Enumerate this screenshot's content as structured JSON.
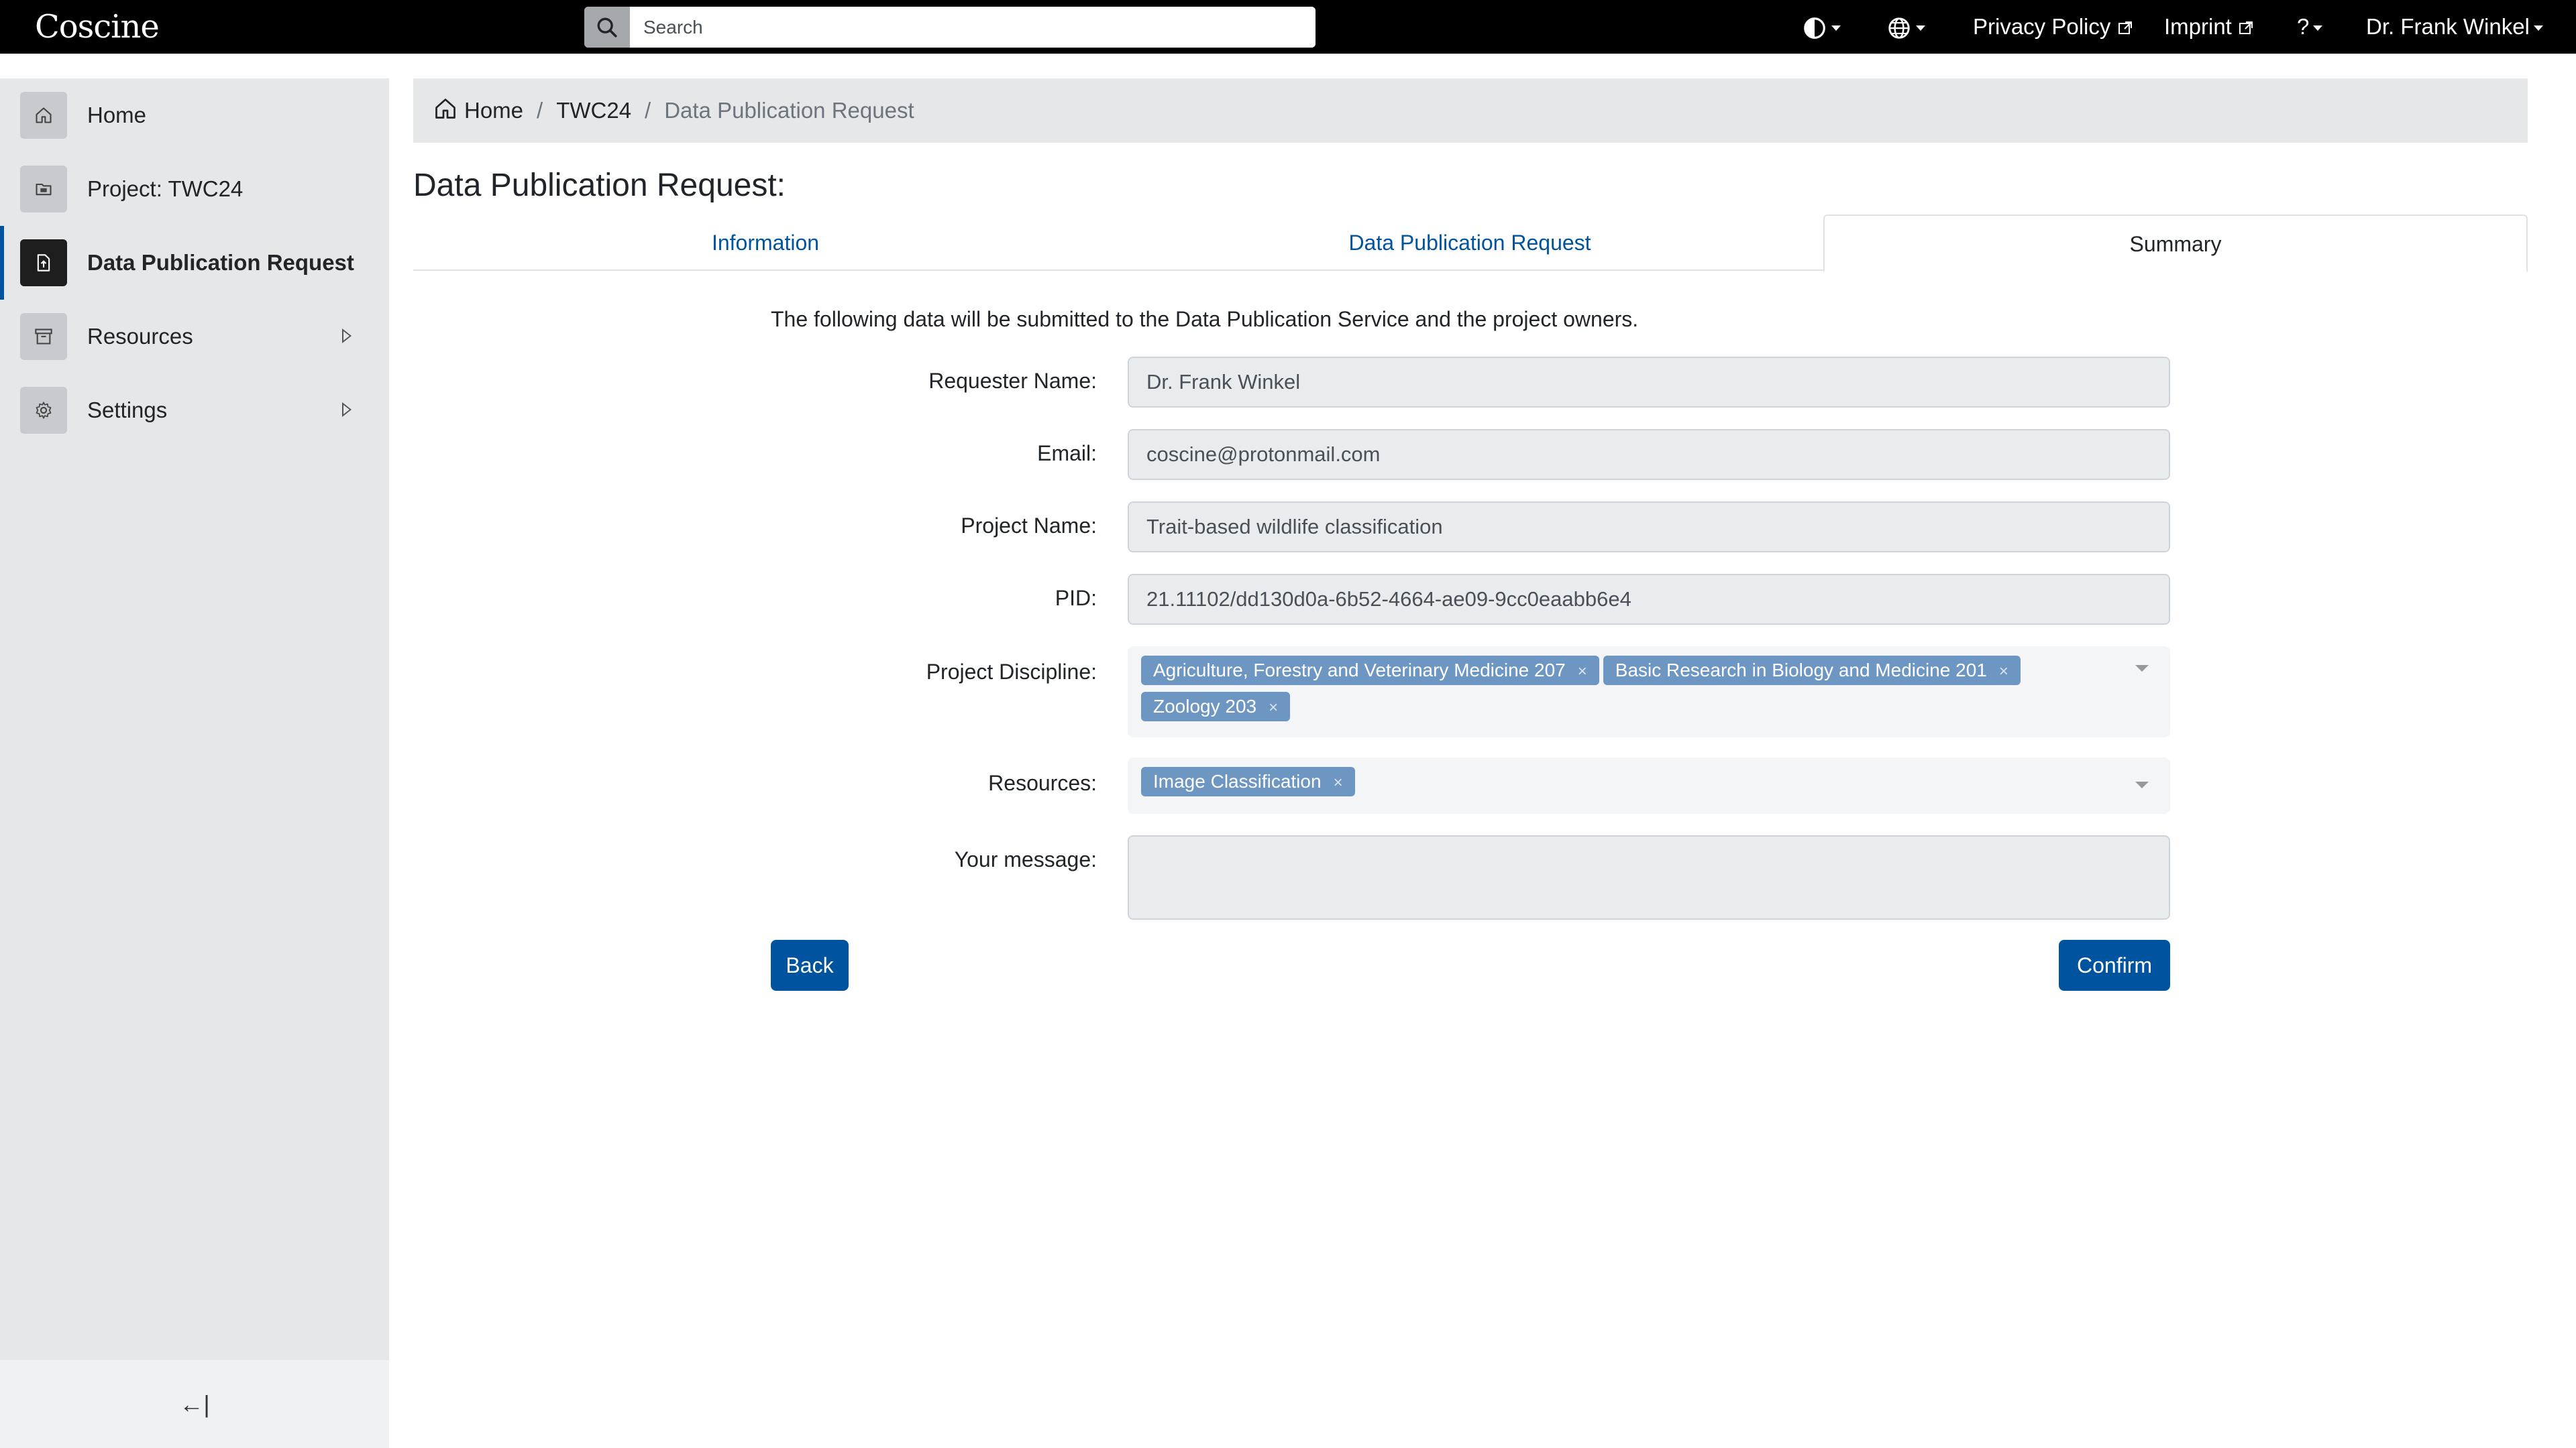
{
  "app": {
    "logo_text": "Coscine"
  },
  "topbar": {
    "search_placeholder": "Search",
    "theme_icon": "contrast-icon",
    "language_icon": "globe-icon",
    "privacy_label": "Privacy Policy",
    "imprint_label": "Imprint",
    "help_label": "?",
    "user_label": "Dr. Frank Winkel"
  },
  "sidebar": {
    "items": [
      {
        "label": "Home",
        "icon": "home-icon"
      },
      {
        "label": "Project: TWC24",
        "icon": "folder-icon"
      },
      {
        "label": "Data Publication Request",
        "icon": "file-upload-icon",
        "active": true
      },
      {
        "label": "Resources",
        "icon": "archive-icon",
        "expandable": true
      },
      {
        "label": "Settings",
        "icon": "gear-icon",
        "expandable": true
      }
    ],
    "collapse_glyph": "←|"
  },
  "breadcrumb": {
    "home": "Home",
    "project": "TWC24",
    "current": "Data Publication Request",
    "separator": "/"
  },
  "page": {
    "title": "Data Publication Request:"
  },
  "tabs": [
    {
      "label": "Information"
    },
    {
      "label": "Data Publication Request"
    },
    {
      "label": "Summary",
      "active": true
    }
  ],
  "summary": {
    "intro": "The following data will be submitted to the Data Publication Service and the project owners.",
    "requester_label": "Requester Name:",
    "requester_value": "Dr. Frank Winkel",
    "email_label": "Email:",
    "email_value": "coscine@protonmail.com",
    "project_name_label": "Project Name:",
    "project_name_value": "Trait-based wildlife classification",
    "pid_label": "PID:",
    "pid_value": "21.11102/dd130d0a-6b52-4664-ae09-9cc0eaabb6e4",
    "discipline_label": "Project Discipline:",
    "disciplines": [
      "Agriculture, Forestry and Veterinary Medicine 207",
      "Basic Research in Biology and Medicine 201",
      "Zoology 203"
    ],
    "resources_label": "Resources:",
    "resources": [
      "Image Classification"
    ],
    "message_label": "Your message:",
    "message_value": "",
    "tag_remove_glyph": "×"
  },
  "actions": {
    "back_label": "Back",
    "confirm_label": "Confirm"
  },
  "colors": {
    "topbar_bg": "#000000",
    "sidebar_bg": "#e6e7e8",
    "primary": "#00549f",
    "tag_bg": "#6d96c3"
  }
}
